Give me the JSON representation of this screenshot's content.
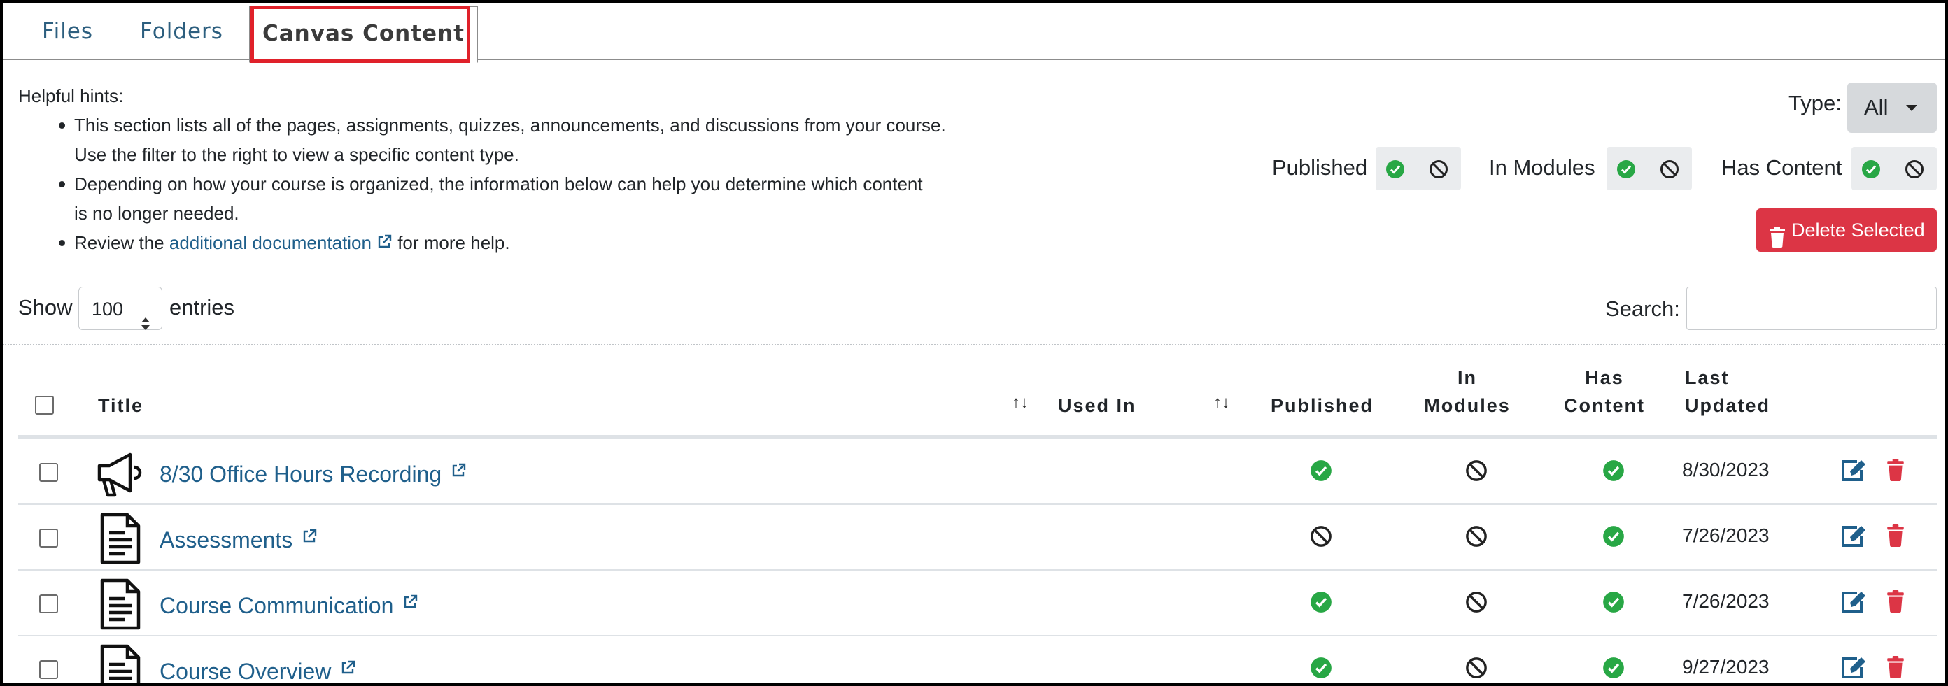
{
  "tabs": [
    {
      "label": "Files"
    },
    {
      "label": "Folders"
    },
    {
      "label": "Canvas Content"
    }
  ],
  "hints": {
    "title": "Helpful hints:",
    "item1": "This section lists all of the pages, assignments, quizzes, announcements, and discussions from your course. Use the filter to the right to view a specific content type.",
    "item1_line1": "This section lists all of the pages, assignments, quizzes, announcements, and discussions from your course.",
    "item1_line2": "Use the filter to the right to view a specific content type.",
    "item2_line1": "Depending on how your course is organized, the information below can help you determine which content",
    "item2_line2": "is no longer needed.",
    "item3_prefix": "Review the",
    "item3_link": "additional documentation",
    "item3_suffix": "for more help."
  },
  "filters": {
    "type_label": "Type:",
    "type_value": "All",
    "published_label": "Published",
    "in_modules_label": "In Modules",
    "has_content_label": "Has Content"
  },
  "actions": {
    "delete_selected": "Delete Selected"
  },
  "table_controls": {
    "show_label": "Show",
    "entries_value": "100",
    "entries_label": "entries",
    "search_label": "Search:",
    "search_value": ""
  },
  "columns": {
    "title": "Title",
    "used_in": "Used In",
    "published": "Published",
    "in_modules_1": "In",
    "in_modules_2": "Modules",
    "has_content_1": "Has",
    "has_content_2": "Content",
    "last_updated_1": "Last",
    "last_updated_2": "Updated",
    "sort_glyph": "↑↓"
  },
  "rows": [
    {
      "type_icon": "megaphone-icon",
      "title": "8/30 Office Hours Recording",
      "used_in": "",
      "published": "check",
      "in_modules": "ban",
      "has_content": "check",
      "last_updated": "8/30/2023"
    },
    {
      "type_icon": "page-icon",
      "title": "Assessments",
      "used_in": "",
      "published": "ban",
      "in_modules": "ban",
      "has_content": "check",
      "last_updated": "7/26/2023"
    },
    {
      "type_icon": "page-icon",
      "title": "Course Communication",
      "used_in": "",
      "published": "check",
      "in_modules": "ban",
      "has_content": "check",
      "last_updated": "7/26/2023"
    },
    {
      "type_icon": "page-icon",
      "title": "Course Overview",
      "used_in": "",
      "published": "check",
      "in_modules": "ban",
      "has_content": "check",
      "last_updated": "9/27/2023"
    }
  ],
  "colors": {
    "link": "#1f5f8b",
    "success": "#28a745",
    "danger": "#dc3545",
    "highlight": "#e0212a"
  }
}
